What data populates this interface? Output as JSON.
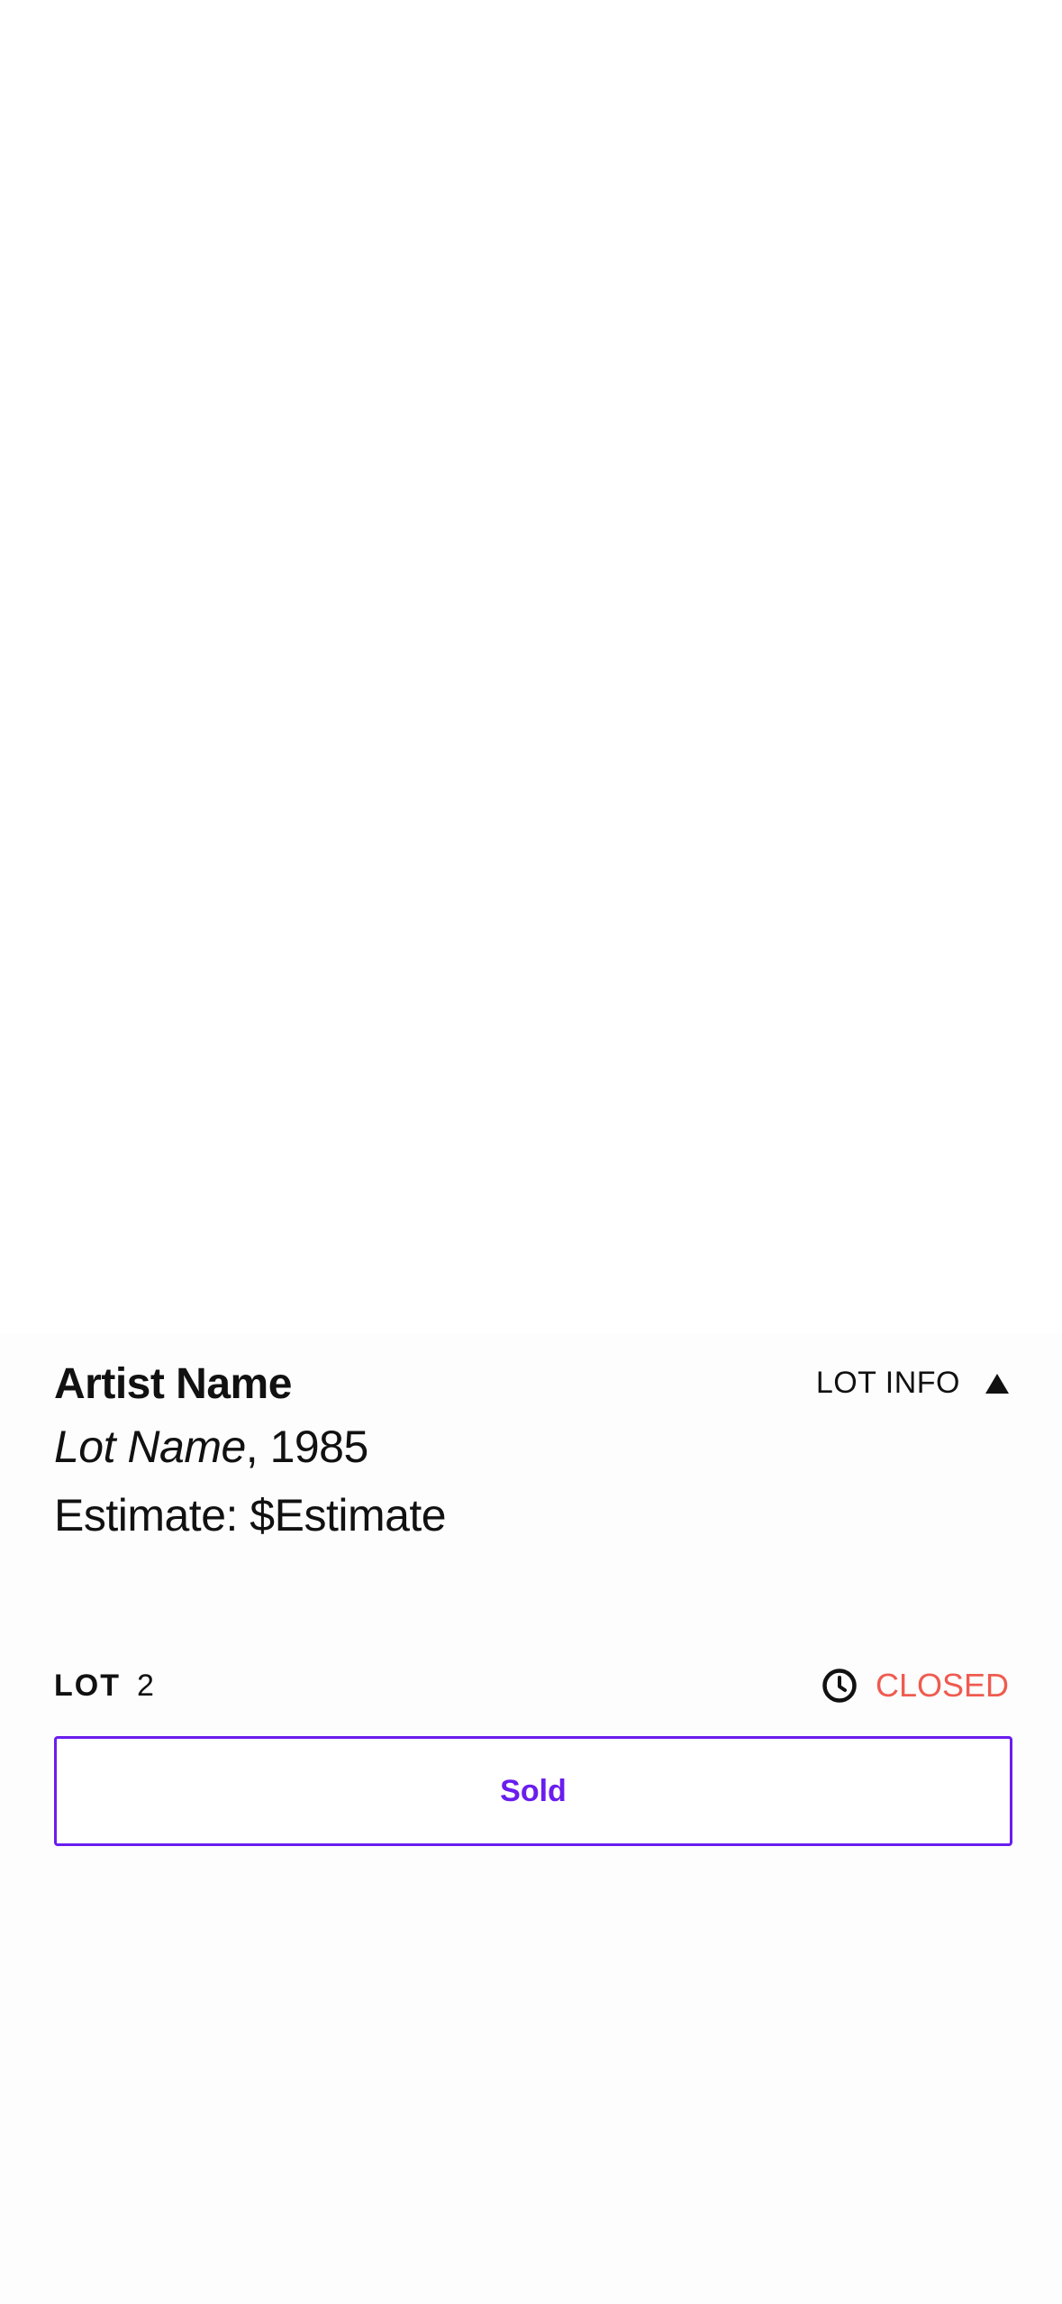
{
  "lot": {
    "artist_name": "Artist Name",
    "lot_name": "Lot Name",
    "year_suffix": ", 1985",
    "estimate": "Estimate: $Estimate",
    "info_toggle_label": "LOT INFO",
    "lot_label": "LOT",
    "lot_number": "2",
    "status": "CLOSED",
    "action_label": "Sold"
  },
  "colors": {
    "status_closed": "#ef5b50",
    "accent_purple": "#6a1dee",
    "text": "#111111"
  },
  "icons": {
    "info_toggle": "triangle-up-icon",
    "status": "clock-icon"
  }
}
